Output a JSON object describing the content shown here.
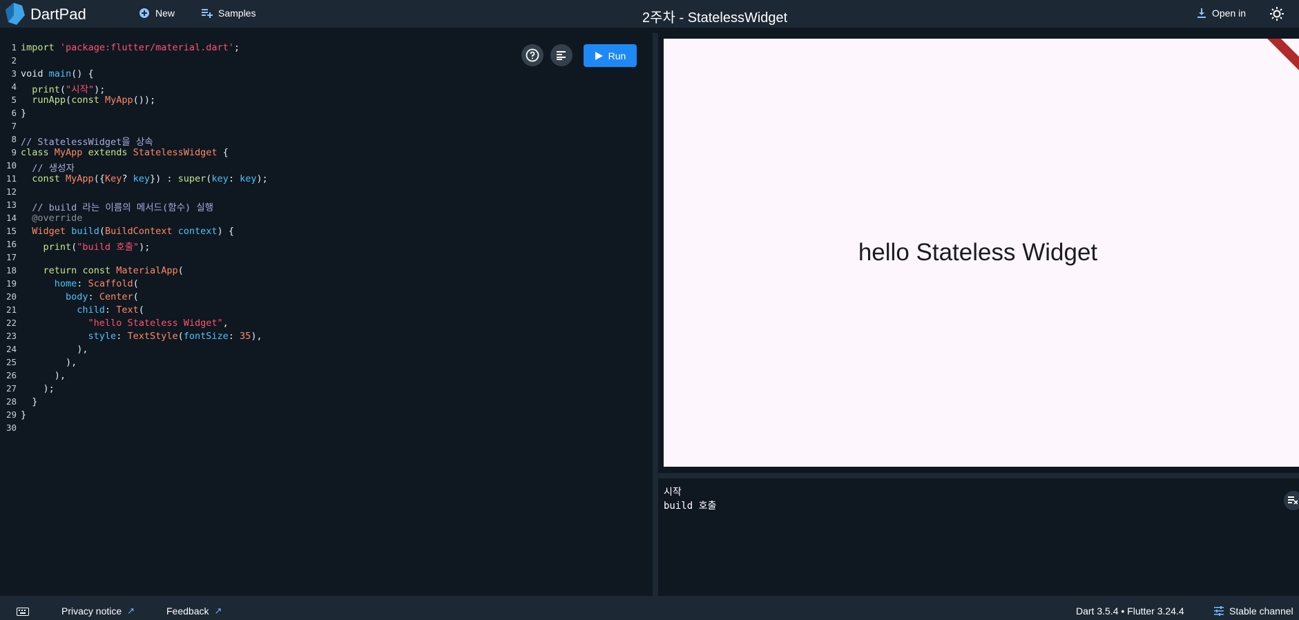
{
  "header": {
    "app_name": "DartPad",
    "new_label": "New",
    "samples_label": "Samples",
    "title": "2주차 - StatelessWidget",
    "open_in_label": "Open in"
  },
  "editor": {
    "run_label": "Run",
    "line_numbers": [
      "1",
      "2",
      "3",
      "4",
      "5",
      "6",
      "7",
      "8",
      "9",
      "10",
      "11",
      "12",
      "13",
      "14",
      "15",
      "16",
      "17",
      "18",
      "19",
      "20",
      "21",
      "22",
      "23",
      "24",
      "25",
      "26",
      "27",
      "28",
      "29",
      "30"
    ]
  },
  "preview": {
    "text": "hello Stateless Widget"
  },
  "console": {
    "lines": [
      "시작",
      "build 호출"
    ]
  },
  "footer": {
    "privacy_label": "Privacy notice",
    "feedback_label": "Feedback",
    "version_label": "Dart 3.5.4 • Flutter 3.24.4",
    "channel_label": "Stable channel"
  },
  "colors": {
    "accent": "#1e88f5",
    "header_bg": "#1c2834",
    "editor_bg": "#0f1720",
    "preview_bg": "#fdf7fd"
  }
}
